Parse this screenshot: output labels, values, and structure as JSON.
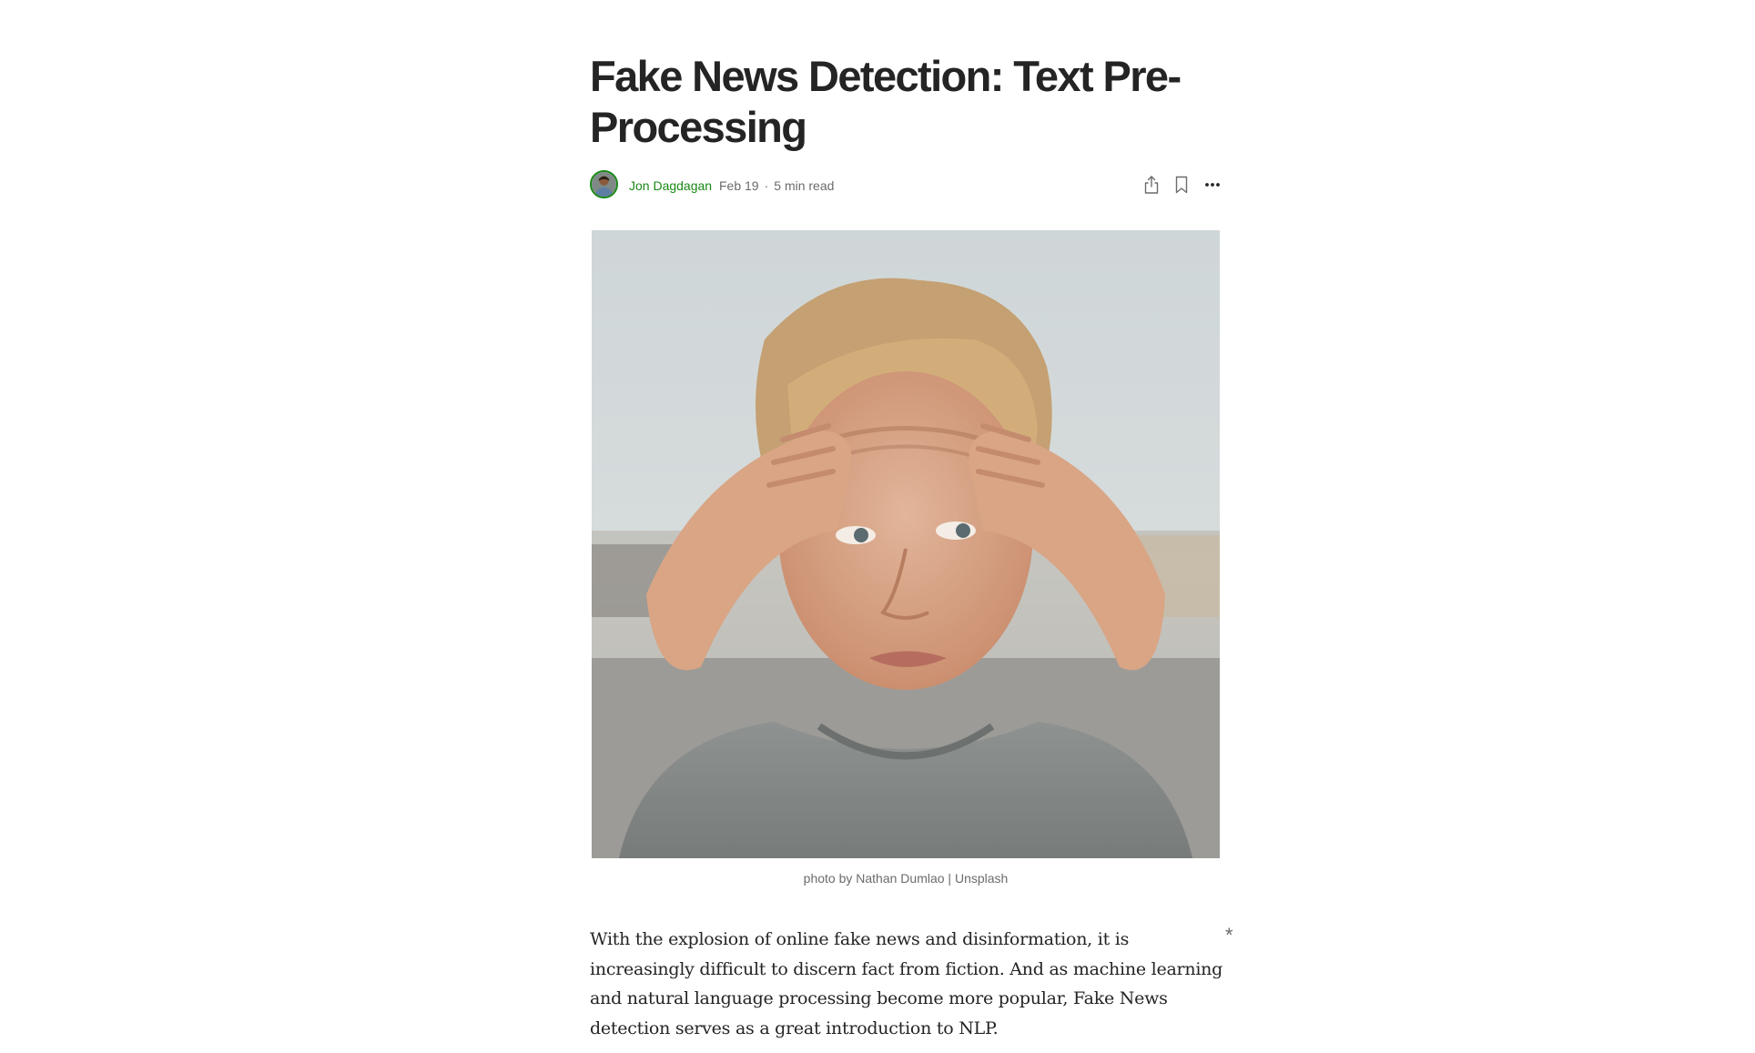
{
  "article": {
    "title": "Fake News Detection: Text Pre-Processing",
    "author": "Jon Dagdagan",
    "date": "Feb 19",
    "separator": "·",
    "read_time": "5 min read",
    "image_caption": "photo by Nathan Dumlao | Unsplash",
    "paragraph": "With the explosion of online fake news and disinformation, it is increasingly difficult to discern fact from fiction. And as machine learning and natural language processing become more popular, Fake News detection serves as a great introduction to NLP.",
    "highlight_marker": "*"
  },
  "icons": {
    "share": "share-icon",
    "bookmark": "bookmark-icon",
    "more": "more-icon",
    "avatar": "author-avatar"
  },
  "colors": {
    "text": "#242424",
    "author_link": "#1a8917",
    "muted": "#6b6b6b"
  }
}
